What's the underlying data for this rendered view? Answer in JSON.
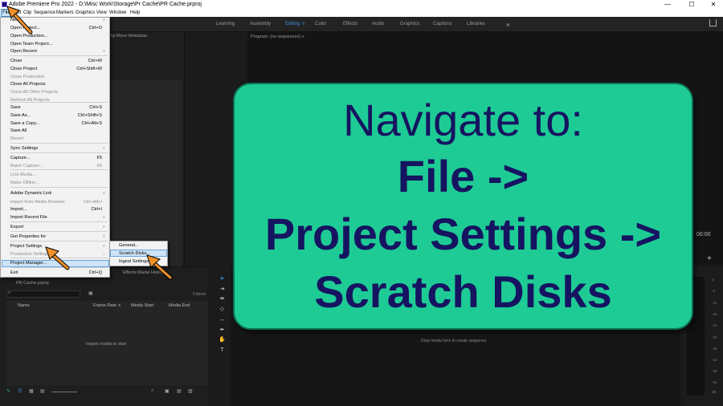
{
  "titlebar": {
    "title": "Adobe Premiere Pro 2022 - D:\\Misc Work\\Storage\\Pr Cache\\PR Cache.prproj",
    "minimize": "—",
    "maximize": "☐",
    "close": "✕"
  },
  "menubar": [
    "File",
    "Edit",
    "Clip",
    "Sequence",
    "Markers",
    "Graphics",
    "View",
    "Window",
    "Help"
  ],
  "workspaces": {
    "tabs": [
      "Learning",
      "Assembly",
      "Editing",
      "Color",
      "Effects",
      "Audio",
      "Graphics",
      "Captions",
      "Libraries"
    ],
    "active": "Editing",
    "more": "»"
  },
  "panels": {
    "source_tabs": "lip Mixer        Metadata",
    "program": "Program: (no sequences)  ≡",
    "timecode": "00:00",
    "project_name": "PR Cache.prproj",
    "item_count": "0 items",
    "columns": [
      "Name",
      "Frame Rate ∧",
      "Media Start",
      "Media End"
    ],
    "empty_message": "Import media to start",
    "effects_tabs": "Effects          Marke            History",
    "timeline_message": "Drop media here to create sequence.",
    "meter_ticks": [
      "0",
      "-6",
      "-12",
      "-18",
      "-24",
      "-30",
      "-36",
      "-42",
      "-48",
      "-54",
      "dB"
    ]
  },
  "file_menu": {
    "items": [
      {
        "label": "New",
        "shortcut": "",
        "submenu": true,
        "disabled": false
      },
      {
        "label": "Open Project...",
        "shortcut": "Ctrl+O",
        "submenu": false,
        "disabled": false
      },
      {
        "label": "Open Production...",
        "shortcut": "",
        "submenu": false,
        "disabled": false
      },
      {
        "label": "Open Team Project...",
        "shortcut": "",
        "submenu": false,
        "disabled": false
      },
      {
        "label": "Open Recent",
        "shortcut": "",
        "submenu": true,
        "disabled": false
      },
      {
        "label": "Close",
        "shortcut": "Ctrl+W",
        "submenu": false,
        "disabled": false
      },
      {
        "label": "Close Project",
        "shortcut": "Ctrl+Shift+W",
        "submenu": false,
        "disabled": false
      },
      {
        "label": "Close Production",
        "shortcut": "",
        "submenu": false,
        "disabled": true
      },
      {
        "label": "Close All Projects",
        "shortcut": "",
        "submenu": false,
        "disabled": false
      },
      {
        "label": "Close All Other Projects",
        "shortcut": "",
        "submenu": false,
        "disabled": true
      },
      {
        "label": "Refresh All Projects",
        "shortcut": "",
        "submenu": false,
        "disabled": true
      },
      {
        "label": "Save",
        "shortcut": "Ctrl+S",
        "submenu": false,
        "disabled": false
      },
      {
        "label": "Save As...",
        "shortcut": "Ctrl+Shift+S",
        "submenu": false,
        "disabled": false
      },
      {
        "label": "Save a Copy...",
        "shortcut": "Ctrl+Alt+S",
        "submenu": false,
        "disabled": false
      },
      {
        "label": "Save All",
        "shortcut": "",
        "submenu": false,
        "disabled": false
      },
      {
        "label": "Revert",
        "shortcut": "",
        "submenu": false,
        "disabled": true
      },
      {
        "label": "Sync Settings",
        "shortcut": "",
        "submenu": true,
        "disabled": false
      },
      {
        "label": "Capture...",
        "shortcut": "F5",
        "submenu": false,
        "disabled": false
      },
      {
        "label": "Batch Capture...",
        "shortcut": "F6",
        "submenu": false,
        "disabled": true
      },
      {
        "label": "Link Media...",
        "shortcut": "",
        "submenu": false,
        "disabled": true
      },
      {
        "label": "Make Offline...",
        "shortcut": "",
        "submenu": false,
        "disabled": true
      },
      {
        "label": "Adobe Dynamic Link",
        "shortcut": "",
        "submenu": true,
        "disabled": false
      },
      {
        "label": "Import from Media Browser",
        "shortcut": "Ctrl+Alt+I",
        "submenu": false,
        "disabled": true
      },
      {
        "label": "Import...",
        "shortcut": "Ctrl+I",
        "submenu": false,
        "disabled": false
      },
      {
        "label": "Import Recent File",
        "shortcut": "",
        "submenu": true,
        "disabled": false
      },
      {
        "label": "Export",
        "shortcut": "",
        "submenu": true,
        "disabled": false
      },
      {
        "label": "Get Properties for",
        "shortcut": "",
        "submenu": true,
        "disabled": false
      },
      {
        "label": "Project Settings",
        "shortcut": "",
        "submenu": true,
        "disabled": false
      },
      {
        "label": "Production Settings",
        "shortcut": "",
        "submenu": true,
        "disabled": true
      },
      {
        "label": "Project Manager...",
        "shortcut": "",
        "submenu": false,
        "disabled": false
      },
      {
        "label": "Exit",
        "shortcut": "Ctrl+Q",
        "submenu": false,
        "disabled": false
      }
    ]
  },
  "project_settings_submenu": [
    "General...",
    "Scratch Disks...",
    "Ingest Settings..."
  ],
  "callout": {
    "line1": "Navigate to:",
    "line2": "File ->",
    "line3": "Project Settings ->",
    "line4": "Scratch Disks"
  },
  "colors": {
    "callout_bg": "#1ecb95",
    "callout_text": "#161461",
    "arrow": "#f0902c",
    "active_workspace": "#3b8fe0"
  }
}
